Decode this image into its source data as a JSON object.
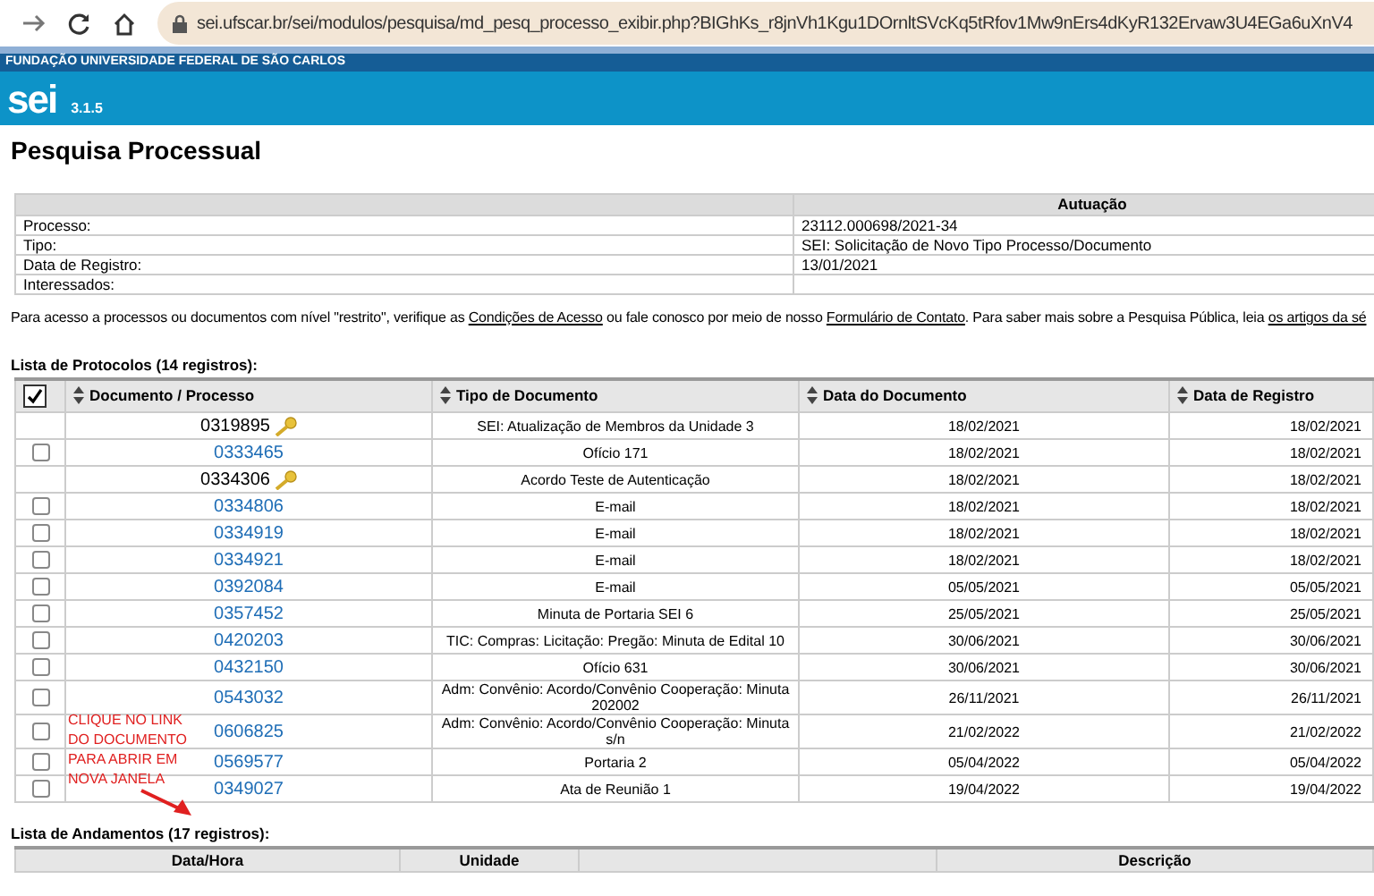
{
  "browser": {
    "url": "sei.ufscar.br/sei/modulos/pesquisa/md_pesq_processo_exibir.php?BIGhKs_r8jnVh1Kgu1DOrnltSVcKq5tRfov1Mw9nErs4dKyR132Ervaw3U4EGa6uXnV4"
  },
  "header": {
    "org": "FUNDAÇÃO UNIVERSIDADE FEDERAL DE SÃO CARLOS",
    "logo": "sei",
    "version": "3.1.5"
  },
  "page_title": "Pesquisa Processual",
  "autuacao": {
    "title": "Autuação",
    "rows": [
      {
        "label": "Processo:",
        "value": "23112.000698/2021-34"
      },
      {
        "label": "Tipo:",
        "value": "SEI: Solicitação de Novo Tipo Processo/Documento"
      },
      {
        "label": "Data de Registro:",
        "value": "13/01/2021"
      },
      {
        "label": "Interessados:",
        "value": ""
      }
    ]
  },
  "notice": {
    "parts": [
      {
        "kind": "text",
        "text": "Para acesso a processos ou documentos com nível \"restrito\", verifique as "
      },
      {
        "kind": "link",
        "text": "Condições de Acesso"
      },
      {
        "kind": "text",
        "text": " ou fale conosco por meio de nosso "
      },
      {
        "kind": "link",
        "text": "Formulário de Contato"
      },
      {
        "kind": "text",
        "text": ". Para saber mais sobre a Pesquisa Pública, leia "
      },
      {
        "kind": "link",
        "text": "os artigos da sé"
      }
    ]
  },
  "protocolos": {
    "title": "Lista de Protocolos (14 registros):",
    "select_all_checked": true,
    "columns": [
      "Documento / Processo",
      "Tipo de Documento",
      "Data do Documento",
      "Data de Registro"
    ],
    "rows": [
      {
        "kind": "restricted",
        "doc": "0319895",
        "tipo": "SEI: Atualização de Membros da Unidade 3",
        "data_doc": "18/02/2021",
        "data_reg": "18/02/2021"
      },
      {
        "kind": "link",
        "checked": false,
        "doc": "0333465",
        "tipo": "Ofício 171",
        "data_doc": "18/02/2021",
        "data_reg": "18/02/2021"
      },
      {
        "kind": "restricted",
        "doc": "0334306",
        "tipo": "Acordo Teste de Autenticação",
        "data_doc": "18/02/2021",
        "data_reg": "18/02/2021"
      },
      {
        "kind": "link",
        "checked": false,
        "doc": "0334806",
        "tipo": "E-mail",
        "data_doc": "18/02/2021",
        "data_reg": "18/02/2021"
      },
      {
        "kind": "link",
        "checked": false,
        "doc": "0334919",
        "tipo": "E-mail",
        "data_doc": "18/02/2021",
        "data_reg": "18/02/2021"
      },
      {
        "kind": "link",
        "checked": false,
        "doc": "0334921",
        "tipo": "E-mail",
        "data_doc": "18/02/2021",
        "data_reg": "18/02/2021"
      },
      {
        "kind": "link",
        "checked": false,
        "doc": "0392084",
        "tipo": "E-mail",
        "data_doc": "05/05/2021",
        "data_reg": "05/05/2021"
      },
      {
        "kind": "link",
        "checked": false,
        "doc": "0357452",
        "tipo": "Minuta de Portaria SEI 6",
        "data_doc": "25/05/2021",
        "data_reg": "25/05/2021"
      },
      {
        "kind": "link",
        "checked": false,
        "doc": "0420203",
        "tipo": "TIC: Compras: Licitação: Pregão: Minuta de Edital 10",
        "data_doc": "30/06/2021",
        "data_reg": "30/06/2021"
      },
      {
        "kind": "link",
        "checked": false,
        "doc": "0432150",
        "tipo": "Ofício 631",
        "data_doc": "30/06/2021",
        "data_reg": "30/06/2021"
      },
      {
        "kind": "link",
        "checked": false,
        "doc": "0543032",
        "tipo": "Adm: Convênio: Acordo/Convênio Cooperação: Minuta 202002",
        "data_doc": "26/11/2021",
        "data_reg": "26/11/2021"
      },
      {
        "kind": "link",
        "checked": false,
        "doc": "0606825",
        "tipo": "Adm: Convênio: Acordo/Convênio Cooperação: Minuta s/n",
        "data_doc": "21/02/2022",
        "data_reg": "21/02/2022"
      },
      {
        "kind": "link",
        "checked": false,
        "doc": "0569577",
        "tipo": "Portaria 2",
        "data_doc": "05/04/2022",
        "data_reg": "05/04/2022"
      },
      {
        "kind": "link",
        "checked": false,
        "doc": "0349027",
        "tipo": "Ata de Reunião 1",
        "data_doc": "19/04/2022",
        "data_reg": "19/04/2022"
      }
    ]
  },
  "annotation": {
    "text": "CLIQUE NO LINK DO DOCUMENTO PARA ABRIR EM NOVA JANELA"
  },
  "andamentos": {
    "title": "Lista de Andamentos (17 registros):",
    "columns": [
      "Data/Hora",
      "Unidade",
      "",
      "Descrição"
    ]
  }
}
